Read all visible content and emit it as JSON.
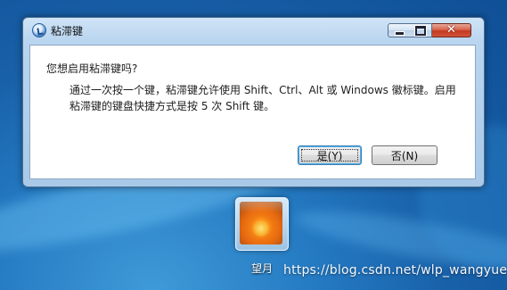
{
  "window": {
    "title": "粘滞键",
    "question": "您想启用粘滞键吗?",
    "detail": "通过一次按一个键，粘滞键允许使用 Shift、Ctrl、Alt 或 Windows 徽标键。启用粘滞键的键盘快捷方式是按 5 次 Shift 键。",
    "buttons": {
      "yes_label": "是(Y)",
      "no_label": "否(N)"
    },
    "controls": {
      "close_glyph": "✕"
    }
  },
  "desktop": {
    "user_name": "望月",
    "watermark": "https://blog.csdn.net/wlp_wangyue"
  }
}
